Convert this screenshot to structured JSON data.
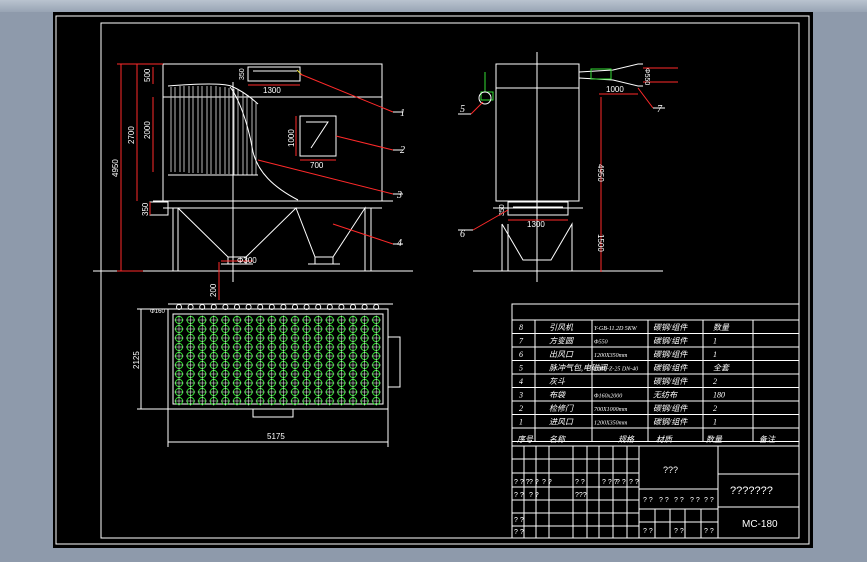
{
  "front_view": {
    "dims": {
      "total_height": "4950",
      "top_section": "500",
      "bags_section": "2000",
      "upper_body": "2700",
      "inlet": "350",
      "width": "5175",
      "outlet_size": "1300",
      "outlet_side": "350",
      "door_height": "1000",
      "door_width": "700",
      "hopper_outlet": "Φ300",
      "bottom_outlet": "200"
    },
    "callouts": [
      "1",
      "2",
      "3",
      "4"
    ]
  },
  "side_view": {
    "dims": {
      "total_height": "4950",
      "lower_height": "1500",
      "duct_width": "1000",
      "pipe_dia": "Φ550",
      "inlet_width": "1300",
      "inlet_side": "350"
    },
    "callouts": [
      "5",
      "6",
      "7"
    ]
  },
  "plan_view": {
    "dims": {
      "depth": "2125",
      "width": "5175",
      "bag_dia": "Φ160"
    }
  },
  "bom": {
    "rows": [
      {
        "no": "8",
        "name": "引风机",
        "spec": "Y-GB-11.2D 5KW",
        "material": "碳钢/组件",
        "qty": "数量"
      },
      {
        "no": "7",
        "name": "方变圆",
        "spec": "Φ550",
        "material": "碳钢/组件",
        "qty": "1"
      },
      {
        "no": "6",
        "name": "出风口",
        "spec": "1200X350mm",
        "material": "碳钢/组件",
        "qty": "1"
      },
      {
        "no": "5",
        "name": "脉冲气包,电磁阀",
        "spec": "DMF-Z-25 DN-40",
        "material": "碳钢/组件",
        "qty": "全套"
      },
      {
        "no": "4",
        "name": "灰斗",
        "spec": "",
        "material": "碳钢/组件",
        "qty": "2"
      },
      {
        "no": "3",
        "name": "布袋",
        "spec": "Φ160x2000",
        "material": "无纺布",
        "qty": "180"
      },
      {
        "no": "2",
        "name": "检修门",
        "spec": "700X1000mm",
        "material": "碳钢/组件",
        "qty": "2"
      },
      {
        "no": "1",
        "name": "进风口",
        "spec": "1200X350mm",
        "material": "碳钢/组件",
        "qty": "1"
      }
    ],
    "headers": {
      "no": "序号",
      "name": "名称",
      "spec": "规格",
      "material": "材质",
      "qty": "数量",
      "remark": "备注"
    }
  },
  "title_block": {
    "title": "???????",
    "center_mark": "???",
    "drawing_no": "MC-180",
    "small_q": "? ?",
    "small_qq": "? ? ?",
    "small_qqq": "???"
  },
  "colors": {
    "background": "#000000",
    "lines": "#ffffff",
    "dims": "#ff2a2a",
    "bags": "#33dd33",
    "accent": "#e8e030"
  }
}
